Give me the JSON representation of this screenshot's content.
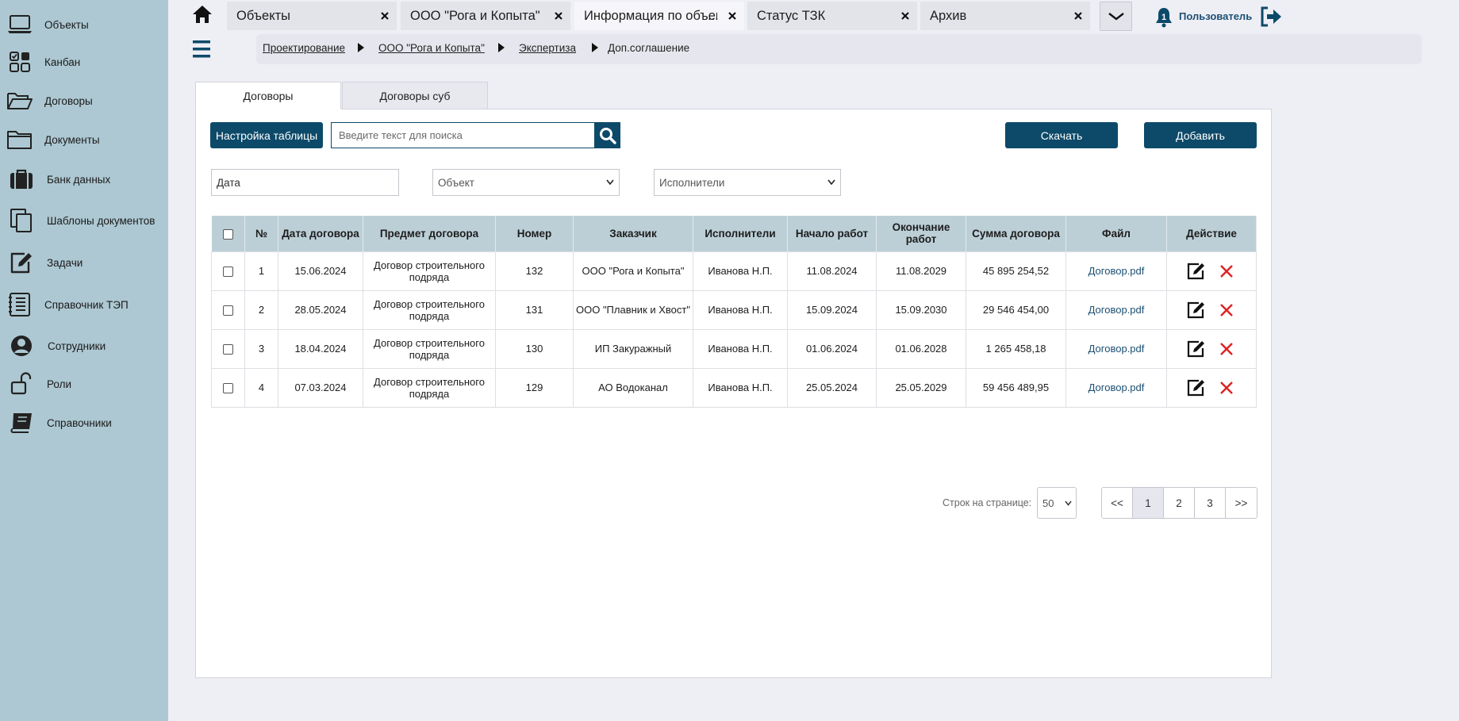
{
  "sidebar": {
    "items": [
      {
        "label": "Объекты",
        "icon": "laptop-icon"
      },
      {
        "label": "Канбан",
        "icon": "kanban-icon"
      },
      {
        "label": "Договоры",
        "icon": "folder-open-icon"
      },
      {
        "label": "Документы",
        "icon": "folder-icon"
      },
      {
        "label": "Банк данных",
        "icon": "briefcase-icon"
      },
      {
        "label": "Шаблоны документов",
        "icon": "copy-icon"
      },
      {
        "label": "Задачи",
        "icon": "edit-icon"
      },
      {
        "label": "Справочник ТЭП",
        "icon": "list-icon"
      },
      {
        "label": "Сотрудники",
        "icon": "user-icon"
      },
      {
        "label": "Роли",
        "icon": "unlock-icon"
      },
      {
        "label": "Справочники",
        "icon": "book-icon"
      }
    ]
  },
  "tabs": [
    {
      "label": "Объекты",
      "active": false
    },
    {
      "label": "ООО \"Рога и Копыта\"",
      "active": false
    },
    {
      "label": "Информация по объекту",
      "active": true
    },
    {
      "label": "Статус ТЗК",
      "active": false
    },
    {
      "label": "Архив",
      "active": false
    }
  ],
  "header": {
    "user_name": "Пользователь",
    "notification_count": "1"
  },
  "breadcrumb": [
    {
      "label": "Проектирование",
      "link": true
    },
    {
      "label": "ООО \"Рога и Копыта\"",
      "link": true
    },
    {
      "label": "Экспертиза",
      "link": true
    },
    {
      "label": "Доп.соглашение",
      "link": false
    }
  ],
  "panel_tabs": [
    {
      "label": "Договоры",
      "active": true
    },
    {
      "label": "Договоры суб",
      "active": false
    }
  ],
  "toolbar": {
    "settings_label": "Настройка таблицы",
    "search_placeholder": "Введите текст для поиска",
    "download_label": "Скачать",
    "add_label": "Добавить"
  },
  "filters": {
    "date": "Дата",
    "object": "Объект",
    "executors": "Исполнители"
  },
  "table": {
    "headers": [
      "№",
      "Дата договора",
      "Предмет договора",
      "Номер",
      "Заказчик",
      "Исполнители",
      "Начало работ",
      "Окончание работ",
      "Сумма договора",
      "Файл",
      "Действие"
    ],
    "rows": [
      {
        "num": "1",
        "date": "15.06.2024",
        "subject": "Договор строительного подряда",
        "number": "132",
        "customer": "ООО \"Рога и Копыта\"",
        "executor": "Иванова Н.П.",
        "start": "11.08.2024",
        "end": "11.08.2029",
        "sum": "45 895 254,52",
        "file": "Договор.pdf"
      },
      {
        "num": "2",
        "date": "28.05.2024",
        "subject": "Договор строительного подряда",
        "number": "131",
        "customer": "ООО \"Плавник и Хвост\"",
        "executor": "Иванова Н.П.",
        "start": "15.09.2024",
        "end": "15.09.2030",
        "sum": "29 546 454,00",
        "file": "Договор.pdf"
      },
      {
        "num": "3",
        "date": "18.04.2024",
        "subject": "Договор строительного подряда",
        "number": "130",
        "customer": "ИП Закуражный",
        "executor": "Иванова Н.П.",
        "start": "01.06.2024",
        "end": "01.06.2028",
        "sum": "1 265 458,18",
        "file": "Договор.pdf"
      },
      {
        "num": "4",
        "date": "07.03.2024",
        "subject": "Договор строительного подряда",
        "number": "129",
        "customer": "АО Водоканал",
        "executor": "Иванова Н.П.",
        "start": "25.05.2024",
        "end": "25.05.2029",
        "sum": "59 456 489,95",
        "file": "Договор.pdf"
      }
    ]
  },
  "pagination": {
    "rows_label": "Строк на странице:",
    "rows_value": "50",
    "pages": [
      "<<",
      "1",
      "2",
      "3",
      ">>"
    ],
    "current": "1"
  },
  "colors": {
    "sidebar_bg": "#adc8d2",
    "accent": "#0d4a69",
    "table_header": "#bccfd7",
    "delete": "#e02020"
  }
}
